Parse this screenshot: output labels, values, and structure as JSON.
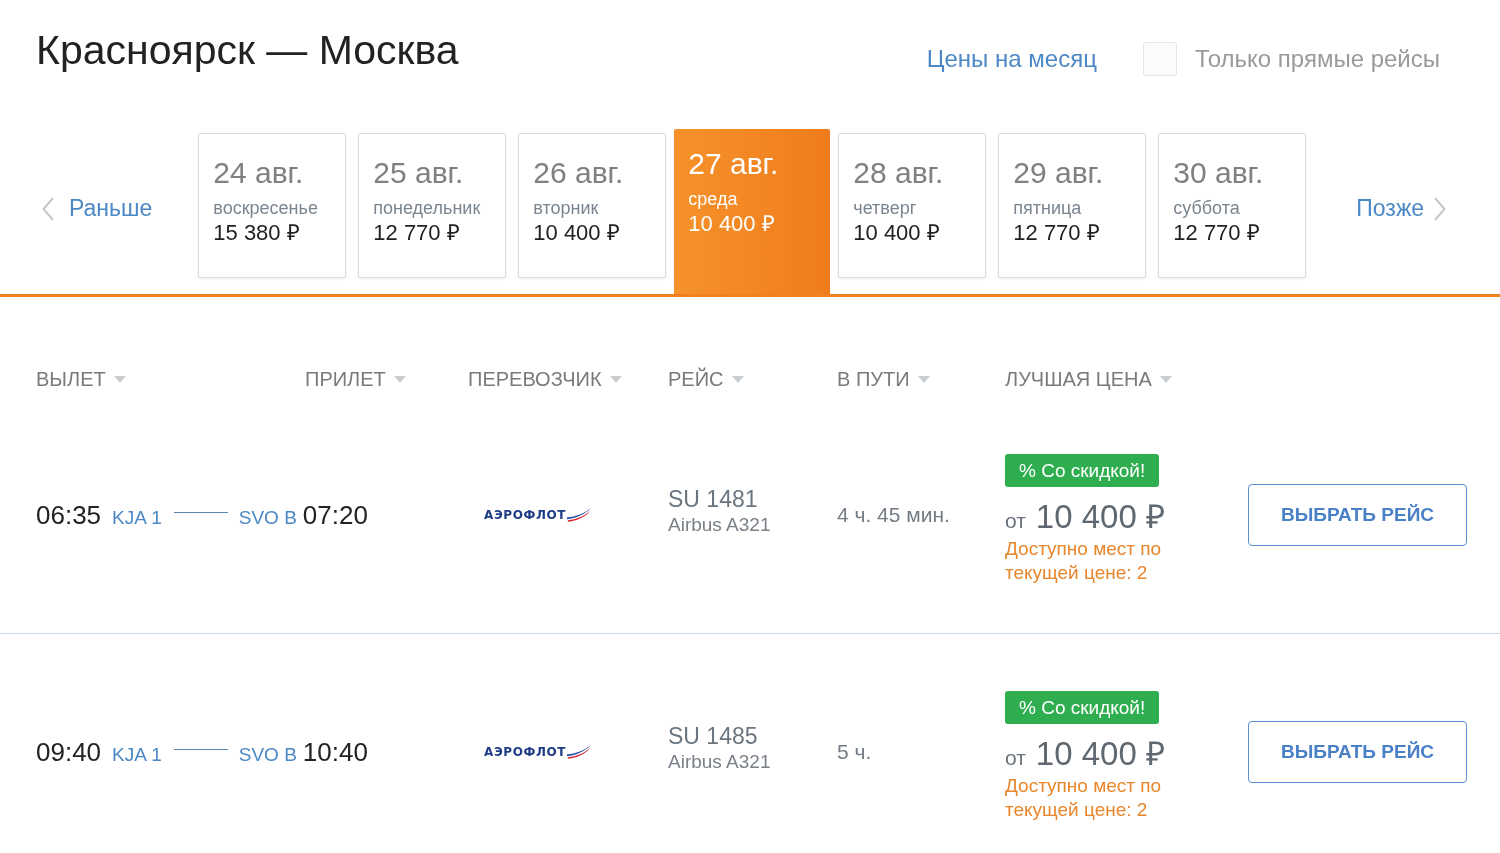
{
  "header": {
    "title": "Красноярск — Москва",
    "month_prices_link": "Цены на месяц",
    "direct_only": {
      "label": "Только прямые рейсы",
      "checked": false
    }
  },
  "date_strip": {
    "earlier": "Раньше",
    "days": [
      {
        "date": "24 авг.",
        "weekday": "воскресенье",
        "price": "15 380 ₽",
        "selected": false
      },
      {
        "date": "25 авг.",
        "weekday": "понедельник",
        "price": "12 770 ₽",
        "selected": false
      },
      {
        "date": "26 авг.",
        "weekday": "вторник",
        "price": "10 400 ₽",
        "selected": false
      },
      {
        "date": "27 авг.",
        "weekday": "среда",
        "price": "10 400 ₽",
        "selected": true
      },
      {
        "date": "28 авг.",
        "weekday": "четверг",
        "price": "10 400 ₽",
        "selected": false
      },
      {
        "date": "29 авг.",
        "weekday": "пятница",
        "price": "12 770 ₽",
        "selected": false
      },
      {
        "date": "30 авг.",
        "weekday": "суббота",
        "price": "12 770 ₽",
        "selected": false
      }
    ],
    "later": "Позже"
  },
  "table": {
    "columns": [
      "ВЫЛЕТ",
      "ПРИЛЕТ",
      "ПЕРЕВОЗЧИК",
      "РЕЙС",
      "В ПУТИ",
      "ЛУЧШАЯ ЦЕНА"
    ],
    "rows": [
      {
        "departure_time": "06:35",
        "origin": "KJA 1",
        "destination": "SVO B",
        "arrival_time": "07:20",
        "carrier_logo": "АЭРОФЛОТ",
        "flight": "SU 1481",
        "aircraft": "Airbus A321",
        "duration": "4 ч. 45 мин.",
        "badge": "% Со скидкой!",
        "price_prefix": "от",
        "price": "10 400 ₽",
        "availability": "Доступно мест по текущей цене: 2",
        "button": "ВЫБРАТЬ РЕЙС"
      },
      {
        "departure_time": "09:40",
        "origin": "KJA 1",
        "destination": "SVO B",
        "arrival_time": "10:40",
        "carrier_logo": "АЭРОФЛОТ",
        "flight": "SU 1485",
        "aircraft": "Airbus A321",
        "duration": "5 ч.",
        "badge": "% Со скидкой!",
        "price_prefix": "от",
        "price": "10 400 ₽",
        "availability": "Доступно мест по текущей цене: 2",
        "button": "ВЫБРАТЬ РЕЙС"
      }
    ]
  }
}
